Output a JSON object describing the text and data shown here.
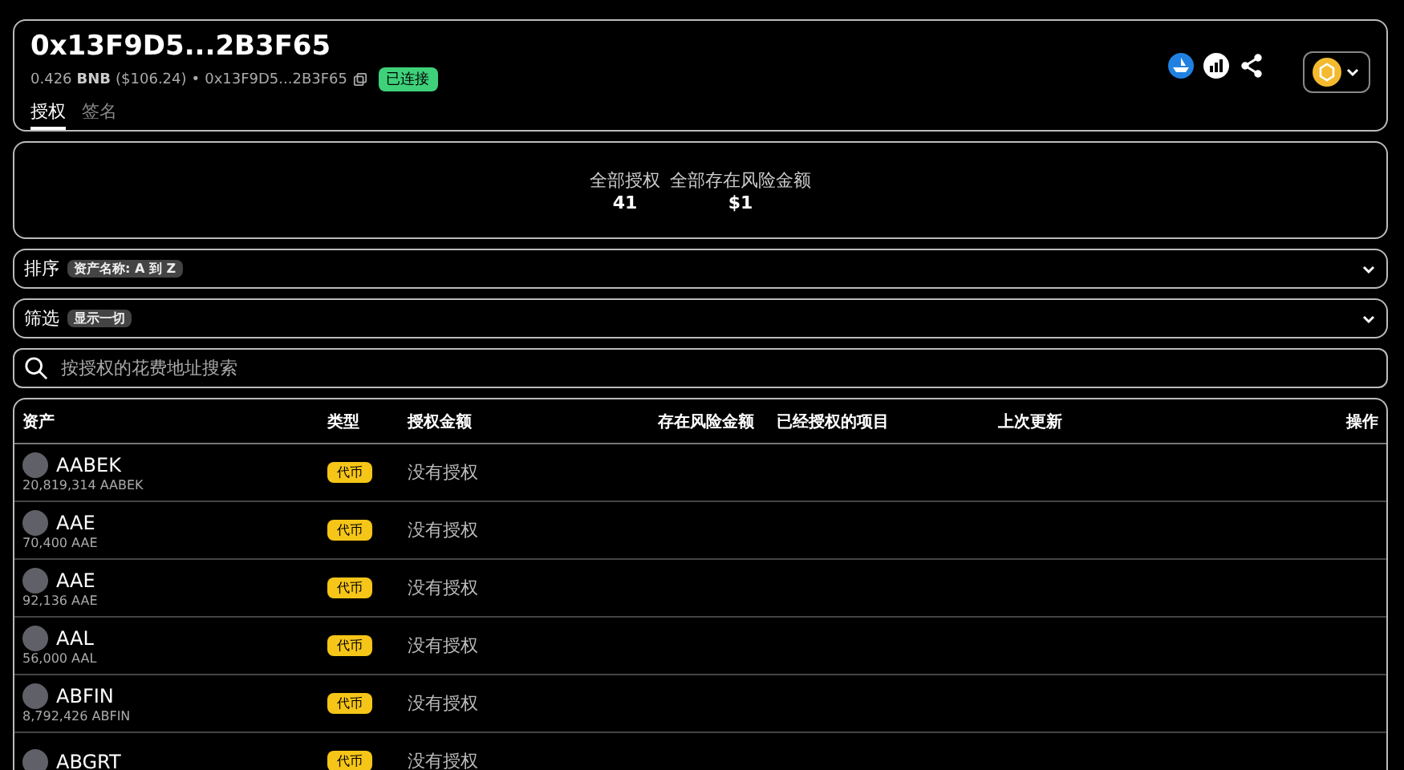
{
  "header": {
    "title": "0x13F9D5...2B3F65",
    "balance_amount": "0.426",
    "balance_symbol": "BNB",
    "balance_usd": "($106.24)",
    "separator": "•",
    "address": "0x13F9D5...2B3F65",
    "status": "已连接",
    "tabs": [
      {
        "label": "授权",
        "selected": true
      },
      {
        "label": "签名",
        "selected": false
      }
    ]
  },
  "summary": [
    {
      "label": "全部授权",
      "value": "41"
    },
    {
      "label": "全部存在风险金额",
      "value": "$1"
    }
  ],
  "sort": {
    "label": "排序",
    "value": "资产名称: A 到 Z"
  },
  "filter": {
    "label": "筛选",
    "value": "显示一切"
  },
  "search": {
    "placeholder": "按授权的花费地址搜索"
  },
  "table": {
    "columns": [
      "资产",
      "类型",
      "授权金额",
      "存在风险金额",
      "已经授权的项目",
      "上次更新",
      "操作"
    ],
    "rows": [
      {
        "asset": "AABEK",
        "balance": "20,819,314 AABEK",
        "type": "代币",
        "amount": "没有授权"
      },
      {
        "asset": "AAE",
        "balance": "70,400 AAE",
        "type": "代币",
        "amount": "没有授权"
      },
      {
        "asset": "AAE",
        "balance": "92,136 AAE",
        "type": "代币",
        "amount": "没有授权"
      },
      {
        "asset": "AAL",
        "balance": "56,000 AAL",
        "type": "代币",
        "amount": "没有授权"
      },
      {
        "asset": "ABFIN",
        "balance": "8,792,426 ABFIN",
        "type": "代币",
        "amount": "没有授权"
      },
      {
        "asset": "ABGRT",
        "type": "代币",
        "amount": "没有授权"
      }
    ]
  }
}
